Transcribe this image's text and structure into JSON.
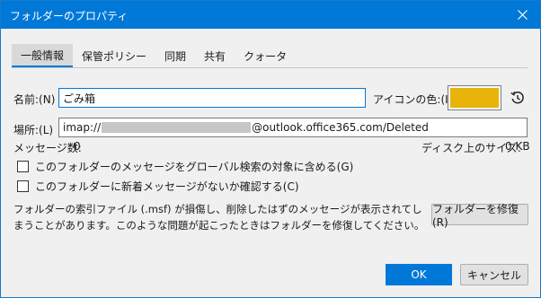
{
  "window": {
    "title": "フォルダーのプロパティ"
  },
  "tabs": [
    {
      "label": "一般情報",
      "active": true
    },
    {
      "label": "保管ポリシー",
      "active": false
    },
    {
      "label": "同期",
      "active": false
    },
    {
      "label": "共有",
      "active": false
    },
    {
      "label": "クォータ",
      "active": false
    }
  ],
  "general": {
    "name_label": "名前:(N)",
    "name_value": "ごみ箱",
    "icon_color_label": "アイコンの色:(I)",
    "icon_color": "#e9b409",
    "location_label": "場所:(L)",
    "location_prefix": "imap://",
    "location_suffix": "@outlook.office365.com/Deleted",
    "message_count_label": "メッセージ数:",
    "message_count_value": "0",
    "disk_size_label": "ディスク上のサイズ:",
    "disk_size_value": "0 KB",
    "checkbox_global_search": "このフォルダーのメッセージをグローバル検索の対象に含める(G)",
    "checkbox_check_new": "このフォルダーに新着メッセージがないか確認する(C)",
    "repair_description": "フォルダーの索引ファイル (.msf) が損傷し、削除したはずのメッセージが表示されてしまうことがあります。このような問題が起こったときはフォルダーを修復してください。",
    "repair_button": "フォルダーを修復(R)"
  },
  "footer": {
    "ok_label": "OK",
    "cancel_label": "キャンセル"
  }
}
